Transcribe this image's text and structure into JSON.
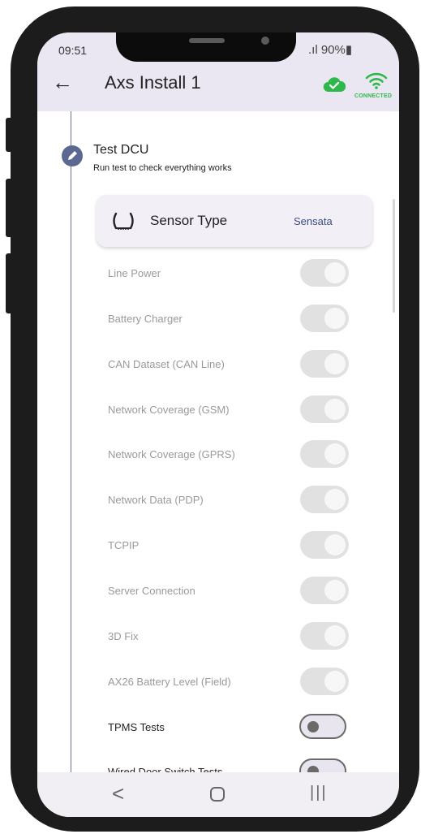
{
  "status_bar": {
    "time": "09:51",
    "battery": " .ıl 90%▮"
  },
  "app_bar": {
    "title": "Axs Install 1",
    "connection_label": "CONNECTED"
  },
  "step": {
    "title": "Test DCU",
    "subtitle": "Run test to check everything works"
  },
  "sensor": {
    "label": "Sensor Type",
    "value": "Sensata"
  },
  "tests": [
    {
      "label": "Line Power",
      "enabled": false
    },
    {
      "label": "Battery Charger",
      "enabled": false
    },
    {
      "label": "CAN Dataset (CAN Line)",
      "enabled": false
    },
    {
      "label": "Network Coverage (GSM)",
      "enabled": false
    },
    {
      "label": "Network Coverage (GPRS)",
      "enabled": false
    },
    {
      "label": "Network Data (PDP)",
      "enabled": false
    },
    {
      "label": "TCPIP",
      "enabled": false
    },
    {
      "label": "Server Connection",
      "enabled": false
    },
    {
      "label": "3D Fix",
      "enabled": false
    },
    {
      "label": "AX26 Battery Level (Field)",
      "enabled": false
    },
    {
      "label": "TPMS Tests",
      "enabled": true
    },
    {
      "label": "Wired Door Switch Tests",
      "enabled": true
    }
  ],
  "nav": {
    "back": "<",
    "recent": "|||"
  },
  "colors": {
    "accent": "#5c6891",
    "connected": "#2eb84b",
    "header_bg": "#ebe7f2",
    "sensor_value": "#3c4b80"
  }
}
